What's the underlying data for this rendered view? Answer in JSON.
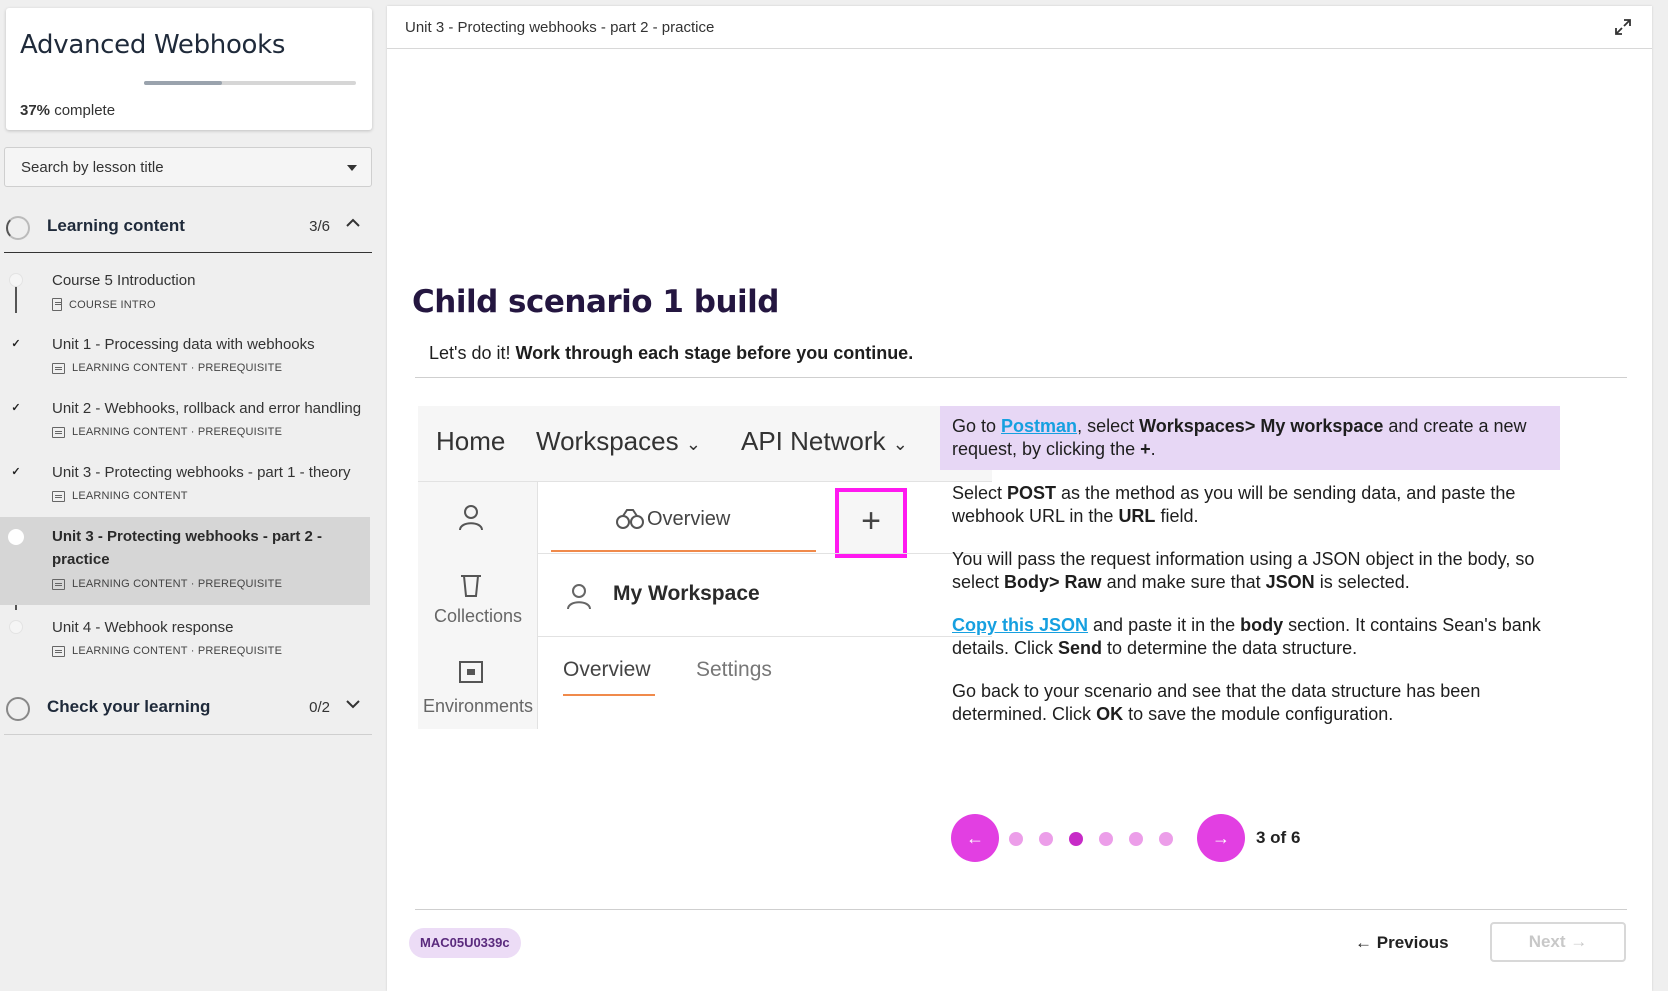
{
  "sidebar": {
    "course_title": "Advanced Webhooks",
    "progress_percent": 37,
    "progress_value": "37%",
    "progress_label": "complete",
    "search_placeholder": "Search by lesson title",
    "sections": [
      {
        "title": "Learning content",
        "count": "3/6",
        "expanded": true
      },
      {
        "title": "Check your learning",
        "count": "0/2",
        "expanded": false
      }
    ],
    "lessons": [
      {
        "title": "Course 5 Introduction",
        "meta": "COURSE INTRO",
        "status": "not-started",
        "icon": "document-icon"
      },
      {
        "title": "Unit 1 - Processing data with webhooks",
        "meta": "LEARNING CONTENT · PREREQUISITE",
        "status": "complete",
        "icon": "slides-icon"
      },
      {
        "title": "Unit 2 - Webhooks, rollback and error handling",
        "meta": "LEARNING CONTENT · PREREQUISITE",
        "status": "complete",
        "icon": "slides-icon"
      },
      {
        "title": "Unit 3 - Protecting webhooks - part 1 - theory",
        "meta": "LEARNING CONTENT",
        "status": "complete",
        "icon": "slides-icon"
      },
      {
        "title_line1": "Unit 3 - Protecting webhooks - part 2 -",
        "title_line2": "practice",
        "meta": "LEARNING CONTENT · PREREQUISITE",
        "status": "current",
        "icon": "slides-icon"
      },
      {
        "title": "Unit 4 - Webhook response",
        "meta": "LEARNING CONTENT · PREREQUISITE",
        "status": "not-started",
        "icon": "slides-icon"
      }
    ]
  },
  "main": {
    "header_title": "Unit 3 - Protecting webhooks - part 2 - practice",
    "heading": "Child scenario 1 build",
    "intro_plain": "Let's do it! ",
    "intro_bold": "Work through each stage before you continue.",
    "screenshot": {
      "nav": [
        "Home",
        "Workspaces",
        "API Network"
      ],
      "sidebar_items": [
        "Collections",
        "Environments"
      ],
      "tab_overview": "Overview",
      "plus_glyph": "+",
      "workspace_title": "My Workspace",
      "workspace_tabs": [
        "Overview",
        "Settings"
      ]
    },
    "steps": {
      "s1": {
        "a": "Go to ",
        "link": "Postman",
        "b": ", select ",
        "bold1": "Workspaces> My workspace",
        "c": " and create a new request, by clicking the ",
        "bold2": "+",
        "d": "."
      },
      "s2": {
        "a": "Select ",
        "bold1": "POST",
        "b": " as the method as you will be sending data, and paste the webhook URL in the ",
        "bold2": "URL",
        "c": " field."
      },
      "s3": {
        "a": "You will pass the request information using a JSON object in the body, so select ",
        "bold1": "Body> Raw",
        "b": " and make sure that ",
        "bold2": "JSON",
        "c": " is selected."
      },
      "s4": {
        "link": "Copy this JSON",
        "a": " and paste it in the ",
        "bold1": "body",
        "b": " section. It contains Sean's bank details. Click ",
        "bold2": "Send",
        "c": " to determine the data structure."
      },
      "s5": {
        "a": "Go back to your scenario and see that the data structure has been determined. Click ",
        "bold1": "OK",
        "b": " to save the module configuration."
      }
    },
    "pager": {
      "current": 3,
      "total": 6,
      "label": "3 of 6"
    },
    "code_badge": "MAC05U0339c",
    "previous_label": "Previous",
    "next_label": "Next"
  },
  "colors": {
    "accent": "#e23fe2",
    "highlight": "#e7d7f5",
    "link": "#16a0e0",
    "heading": "#241640"
  }
}
